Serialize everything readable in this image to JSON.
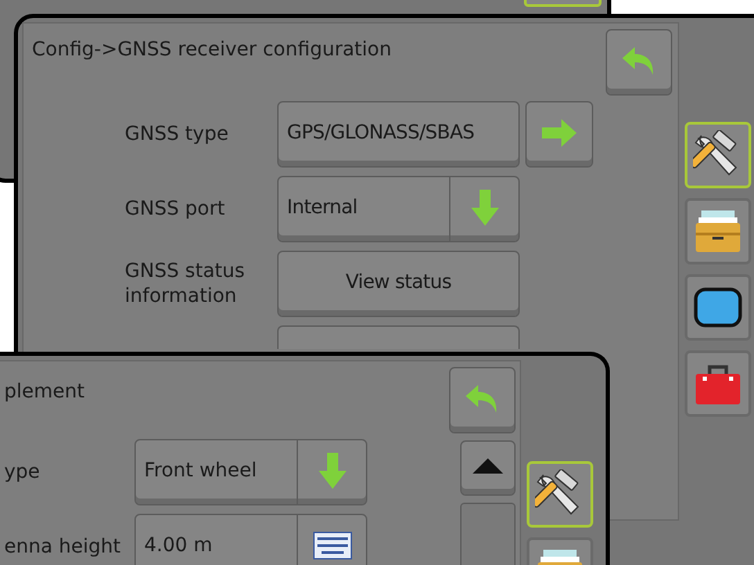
{
  "gnss_window": {
    "title": "Config->GNSS receiver configuration",
    "rows": [
      {
        "kind": "arrow-button",
        "label": "GNSS type",
        "value": "GPS/GLONASS/SBAS"
      },
      {
        "kind": "dropdown",
        "label": "GNSS port",
        "value": "Internal"
      },
      {
        "kind": "button",
        "label": "GNSS status information",
        "value": "View status"
      }
    ],
    "side_tabs": [
      {
        "kind": "tools",
        "selected": true
      },
      {
        "kind": "drawer",
        "selected": false
      },
      {
        "kind": "screen",
        "selected": false
      },
      {
        "kind": "toolbox",
        "selected": false
      }
    ]
  },
  "implement_window": {
    "title": "plement",
    "rows": [
      {
        "kind": "dropdown",
        "label": "ype",
        "value": "Front wheel"
      },
      {
        "kind": "keypad",
        "label": "enna height",
        "value": "4.00 m"
      }
    ],
    "side_tabs": [
      {
        "kind": "tools",
        "selected": true
      },
      {
        "kind": "drawer",
        "selected": false
      }
    ]
  }
}
